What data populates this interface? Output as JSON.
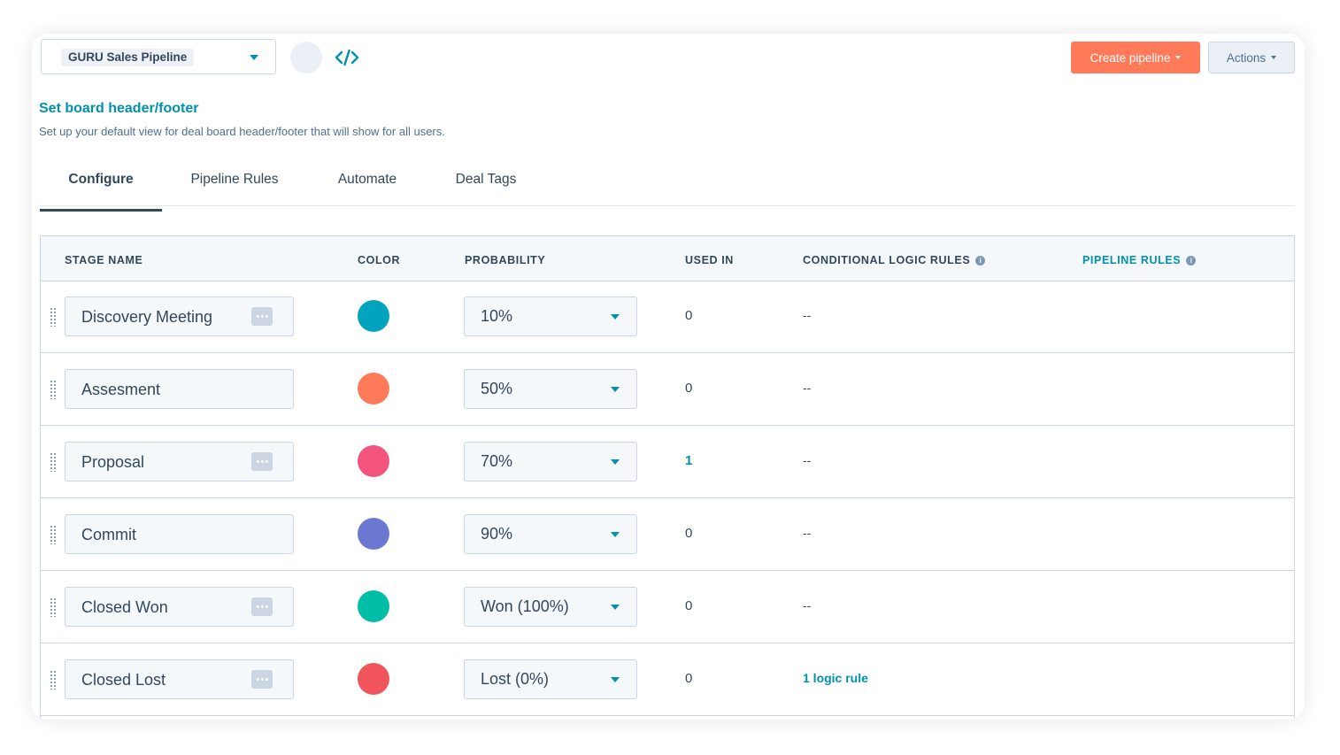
{
  "toolbar": {
    "pipeline_name": "GURU Sales Pipeline",
    "create_label": "Create pipeline",
    "actions_label": "Actions"
  },
  "section": {
    "title": "Set board header/footer",
    "description": "Set up your default view for deal board header/footer that will show for all users."
  },
  "tabs": [
    {
      "label": "Configure",
      "active": true
    },
    {
      "label": "Pipeline Rules",
      "active": false
    },
    {
      "label": "Automate",
      "active": false
    },
    {
      "label": "Deal Tags",
      "active": false
    }
  ],
  "table": {
    "headers": {
      "stage_name": "STAGE NAME",
      "color": "COLOR",
      "probability": "PROBABILITY",
      "used_in": "USED IN",
      "conditional_logic_rules": "CONDITIONAL LOGIC RULES",
      "pipeline_rules": "PIPELINE RULES"
    },
    "rows": [
      {
        "stage": "Discovery Meeting",
        "color": "#00a4bd",
        "probability": "10%",
        "used_in": "0",
        "conditional": "--",
        "has_more": true
      },
      {
        "stage": "Assesment",
        "color": "#ff7a59",
        "probability": "50%",
        "used_in": "0",
        "conditional": "--",
        "has_more": false
      },
      {
        "stage": "Proposal",
        "color": "#f2547d",
        "probability": "70%",
        "used_in": "1",
        "conditional": "--",
        "has_more": true
      },
      {
        "stage": "Commit",
        "color": "#6a78d1",
        "probability": "90%",
        "used_in": "0",
        "conditional": "--",
        "has_more": false
      },
      {
        "stage": "Closed Won",
        "color": "#00bda5",
        "probability": "Won (100%)",
        "used_in": "0",
        "conditional": "--",
        "has_more": true
      },
      {
        "stage": "Closed Lost",
        "color": "#f2545b",
        "probability": "Lost (0%)",
        "used_in": "0",
        "conditional": "1 logic rule",
        "has_more": true
      }
    ]
  },
  "colors": {
    "accent": "#0091ae",
    "primary_button": "#ff7a59",
    "text": "#33475b"
  },
  "icons": {
    "code": "code-icon",
    "dropdown": "chevron-down-icon",
    "info": "info-icon",
    "drag": "drag-handle-icon",
    "more": "more-icon"
  }
}
